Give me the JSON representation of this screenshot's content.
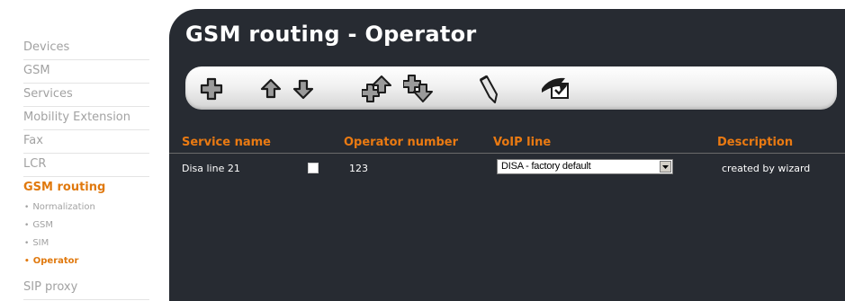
{
  "sidebar": {
    "items": [
      {
        "label": "Devices"
      },
      {
        "label": "GSM"
      },
      {
        "label": "Services"
      },
      {
        "label": "Mobility Extension"
      },
      {
        "label": "Fax"
      },
      {
        "label": "LCR"
      },
      {
        "label": "GSM routing"
      },
      {
        "label": "SIP proxy"
      }
    ],
    "sub_items": [
      {
        "label": "Normalization"
      },
      {
        "label": "GSM"
      },
      {
        "label": "SIM"
      },
      {
        "label": "Operator"
      }
    ],
    "active_item": "GSM routing",
    "active_sub_item": "Operator",
    "bullet": "•"
  },
  "page": {
    "title": "GSM routing - Operator"
  },
  "toolbar": {
    "buttons": [
      {
        "icon": "add-icon"
      },
      {
        "icon": "arrow-up-icon"
      },
      {
        "icon": "arrow-down-icon"
      },
      {
        "icon": "move-to-top-icon"
      },
      {
        "icon": "move-to-bottom-icon"
      },
      {
        "icon": "edit-pencil-icon"
      },
      {
        "icon": "select-all-icon"
      }
    ]
  },
  "table": {
    "columns": [
      "Service name",
      "Operator number",
      "VoIP line",
      "Description"
    ],
    "rows": [
      {
        "service_name": "Disa line 21",
        "checked": false,
        "operator_number": "123",
        "voip_line": "DISA - factory default",
        "description": "created by wizard"
      }
    ]
  },
  "colors": {
    "accent": "#e0790e",
    "panel_bg": "#272b32",
    "inactive_nav": "#a2a2a2"
  }
}
